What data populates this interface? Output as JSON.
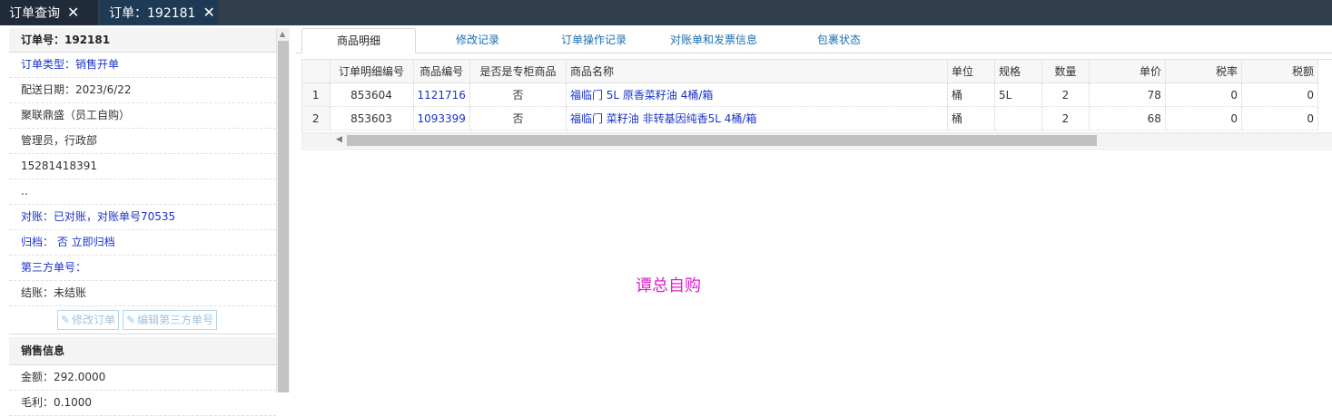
{
  "window_tabs": [
    {
      "label": "订单查询"
    },
    {
      "label": "订单：192181"
    }
  ],
  "left": {
    "order_no": "订单号：192181",
    "rows": [
      {
        "text": "订单类型：销售开单",
        "blue": true
      },
      {
        "text": "配送日期：2023/6/22",
        "blue": false
      },
      {
        "text": "聚联鼎盛（员工自购）",
        "blue": false
      },
      {
        "text": "管理员，行政部",
        "blue": false
      },
      {
        "text": "15281418391",
        "blue": false
      },
      {
        "text": "..",
        "blue": false
      },
      {
        "text": "对账：已对账，对账单号70535",
        "blue": true
      },
      {
        "text": "归档：  否 立即归档",
        "blue": true
      },
      {
        "text": "第三方单号：",
        "blue": true
      },
      {
        "text": "结账：未结账",
        "blue": false
      }
    ],
    "buttons": {
      "edit_order": "修改订单",
      "edit_third_party": "编辑第三方单号"
    },
    "sales_header": "销售信息",
    "amount": "金额：292.0000",
    "partial_row": "毛利：0.1000"
  },
  "tabs": [
    {
      "label": "商品明细"
    },
    {
      "label": "修改记录"
    },
    {
      "label": "订单操作记录"
    },
    {
      "label": "对账单和发票信息"
    },
    {
      "label": "包裹状态"
    }
  ],
  "table": {
    "headers": [
      "",
      "订单明细编号",
      "商品编号",
      "是否是专柜商品",
      "商品名称",
      "单位",
      "规格",
      "数量",
      "单价",
      "税率",
      "税额"
    ],
    "rows": [
      [
        "1",
        "853604",
        "1121716",
        "否",
        "福临门 5L 原香菜籽油 4桶/箱",
        "桶",
        "5L",
        "2",
        "78",
        "0",
        "0"
      ],
      [
        "2",
        "853603",
        "1093399",
        "否",
        "福临门 菜籽油 非转基因纯香5L 4桶/箱",
        "桶",
        "",
        "2",
        "68",
        "0",
        "0"
      ]
    ]
  },
  "watermark": "谭总自购",
  "colors": {
    "topbar": "#2f3d4d",
    "link": "#1a33c9",
    "watermark": "#d91fd0"
  }
}
